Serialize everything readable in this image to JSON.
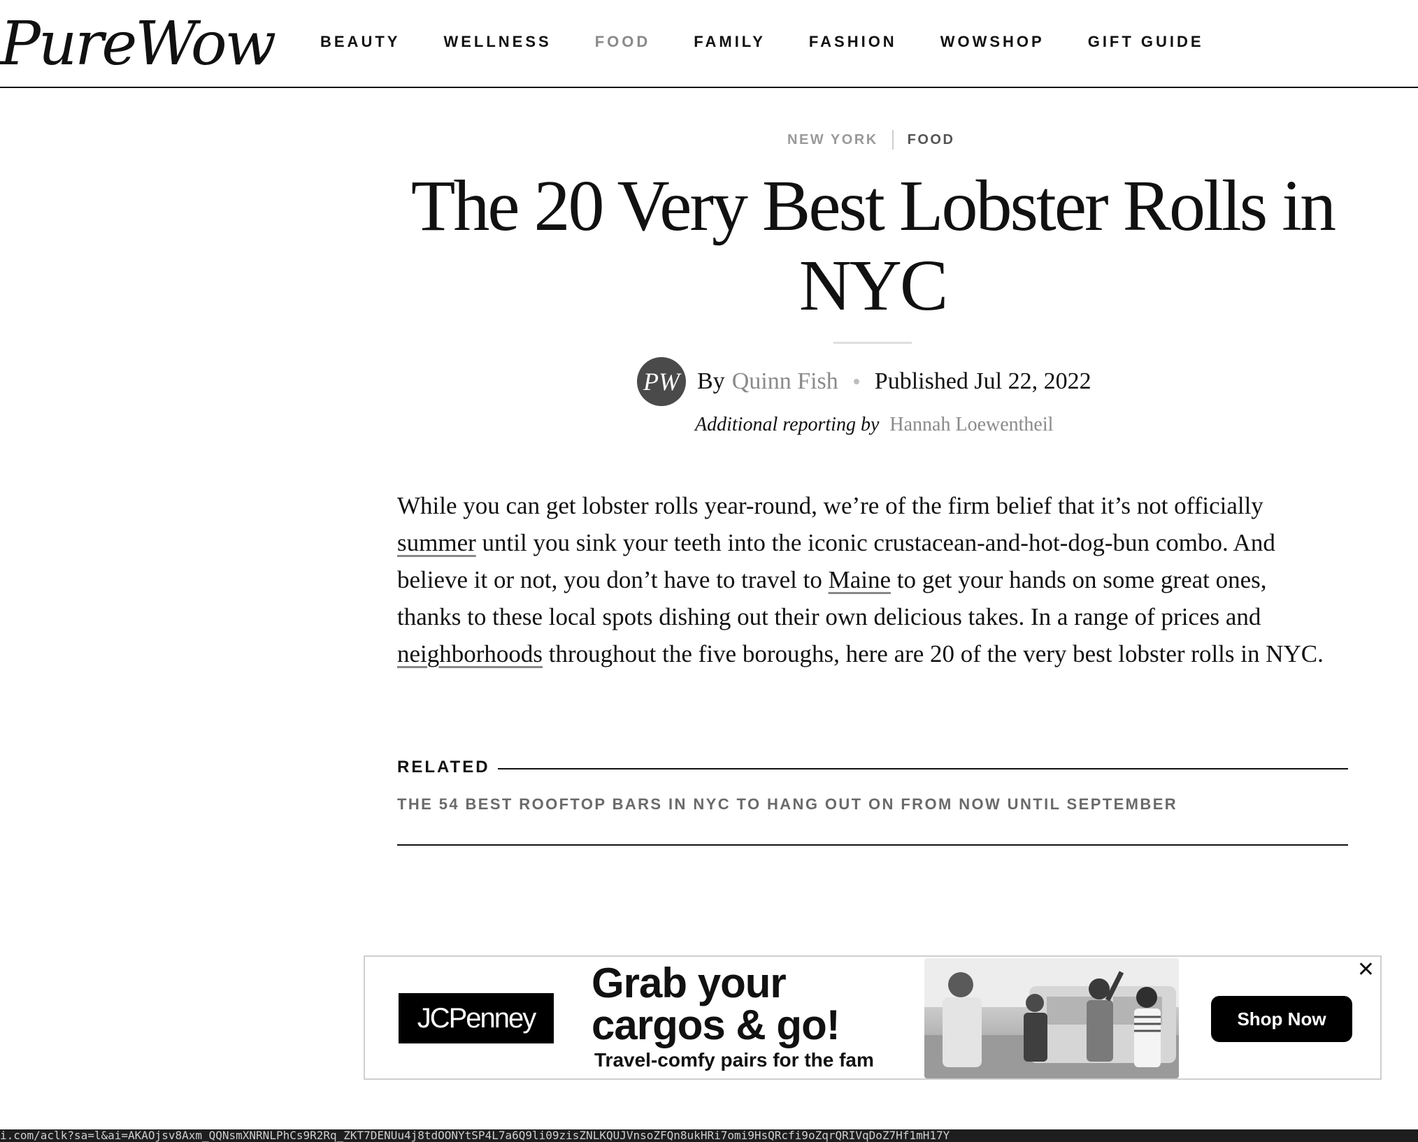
{
  "header": {
    "logo_text": "PureWow",
    "nav": [
      {
        "label": "BEAUTY",
        "active": false
      },
      {
        "label": "WELLNESS",
        "active": false
      },
      {
        "label": "FOOD",
        "active": true
      },
      {
        "label": "FAMILY",
        "active": false
      },
      {
        "label": "FASHION",
        "active": false
      },
      {
        "label": "WOWSHOP",
        "active": false
      },
      {
        "label": "GIFT GUIDE",
        "active": false
      }
    ]
  },
  "article": {
    "breadcrumb": {
      "location": "NEW YORK",
      "section": "FOOD"
    },
    "title": "The 20 Very Best Lobster Rolls in NYC",
    "byline": {
      "avatar_text": "PW",
      "by": "By",
      "author": "Quinn Fish",
      "published": "Published Jul 22, 2022",
      "additional_lead": "Additional reporting by",
      "additional_name": "Hannah Loewentheil"
    },
    "intro": {
      "p1": "While you can get lobster rolls year-round, we’re of the firm belief that it’s not officially ",
      "link_summer": "summer",
      "p2": " until you sink your teeth into the iconic crustacean-and-hot-dog-bun combo. And believe it or not, you don’t have to travel to ",
      "link_maine": "Maine",
      "p3": " to get your hands on some great ones, thanks to these local spots dishing out their own delicious takes. In a range of prices and ",
      "link_neighborhoods": "neighborhoods",
      "p4": " throughout the five boroughs, here are 20 of the very best lobster rolls in NYC."
    },
    "related": {
      "label": "RELATED",
      "link": "THE 54 BEST ROOFTOP BARS IN NYC TO HANG OUT ON FROM NOW UNTIL SEPTEMBER"
    }
  },
  "ad": {
    "brand": "JCPenney",
    "headline_line1": "Grab your",
    "headline_line2": "cargos & go!",
    "subline": "Travel-comfy pairs for the fam",
    "cta": "Shop Now",
    "close_symbol": "✕"
  },
  "status_bar": {
    "text": "i.com/aclk?sa=l&ai=AKAOjsv8Axm_QQNsmXNRNLPhCs9R2Rq_ZKT7DENUu4j8tdOONYtSP4L7a6Q9li09zisZNLKQUJVnsoZFQn8ukHRi7omi9HsQRcfi9oZqrQRIVqDoZ7Hf1mH17Y"
  }
}
